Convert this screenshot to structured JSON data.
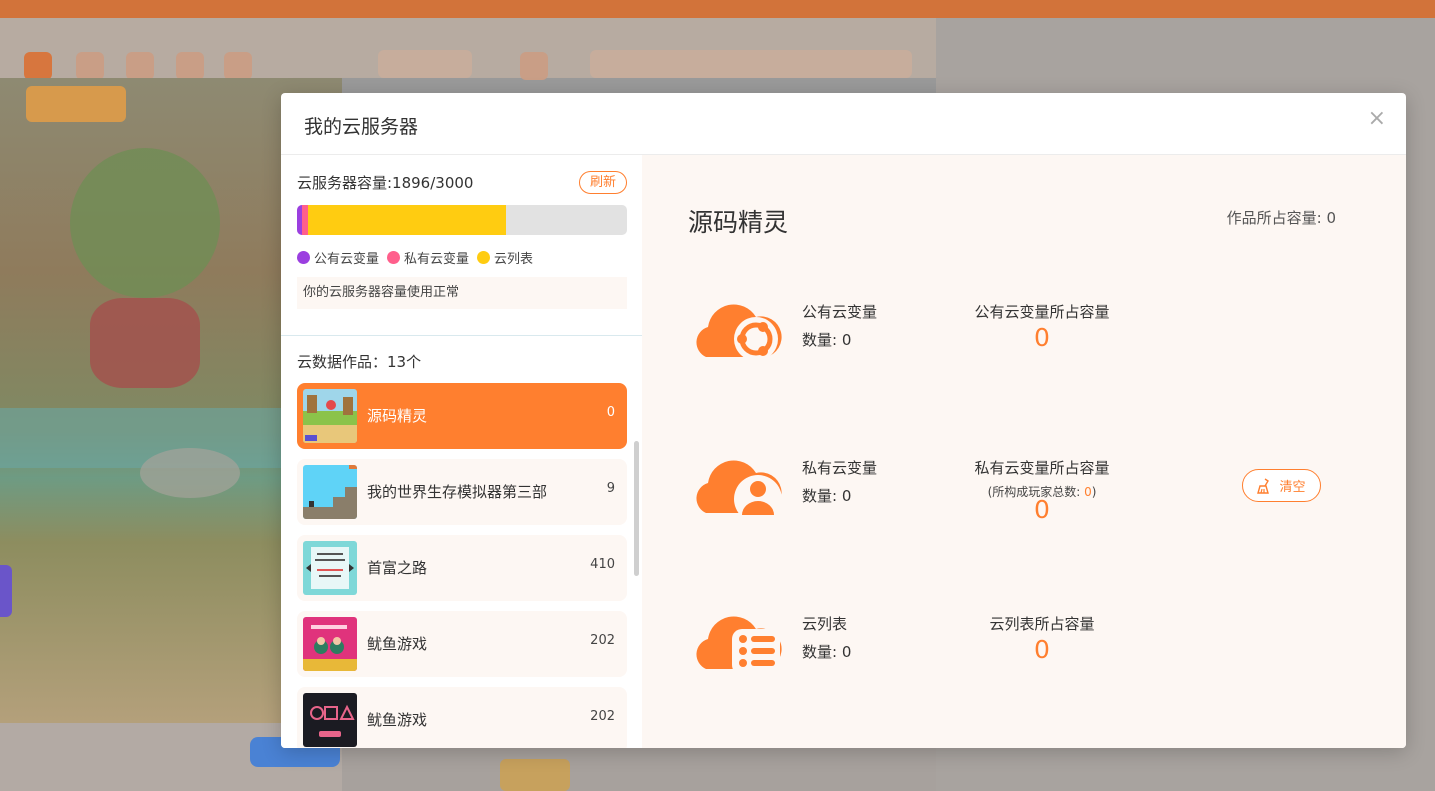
{
  "modal": {
    "title": "我的云服务器",
    "close_glyph": "×"
  },
  "capacity": {
    "label": "云服务器容量:1896/3000",
    "refresh_label": "刷新",
    "used": 1896,
    "total": 3000,
    "status_text": "你的云服务器容量使用正常"
  },
  "legend": [
    {
      "label": "公有云变量",
      "color": "#9b3fe0"
    },
    {
      "label": "私有云变量",
      "color": "#ff5f8c"
    },
    {
      "label": "云列表",
      "color": "#ffcc11"
    }
  ],
  "works": {
    "title": "云数据作品：13个",
    "items": [
      {
        "name": "源码精灵",
        "count": "0",
        "active": true
      },
      {
        "name": "我的世界生存模拟器第三部",
        "count": "9",
        "active": false
      },
      {
        "name": "首富之路",
        "count": "410",
        "active": false
      },
      {
        "name": "鱿鱼游戏",
        "count": "202",
        "active": false
      },
      {
        "name": "鱿鱼游戏",
        "count": "202",
        "active": false
      }
    ]
  },
  "detail": {
    "title": "源码精灵",
    "capacity_label": "作品所占容量: 0",
    "public": {
      "name": "公有云变量",
      "count": "数量: 0",
      "cap_label": "公有云变量所占容量",
      "cap_value": "0"
    },
    "private": {
      "name": "私有云变量",
      "count": "数量: 0",
      "cap_label": "私有云变量所占容量",
      "sub_prefix": "(所构成玩家总数: ",
      "sub_num": "0",
      "sub_suffix": ")",
      "cap_value": "0",
      "clear_label": "清空"
    },
    "list": {
      "name": "云列表",
      "count": "数量: 0",
      "cap_label": "云列表所占容量",
      "cap_value": "0"
    }
  },
  "colors": {
    "accent": "#ff7f2f",
    "panel_bg": "#fdf7f3"
  }
}
